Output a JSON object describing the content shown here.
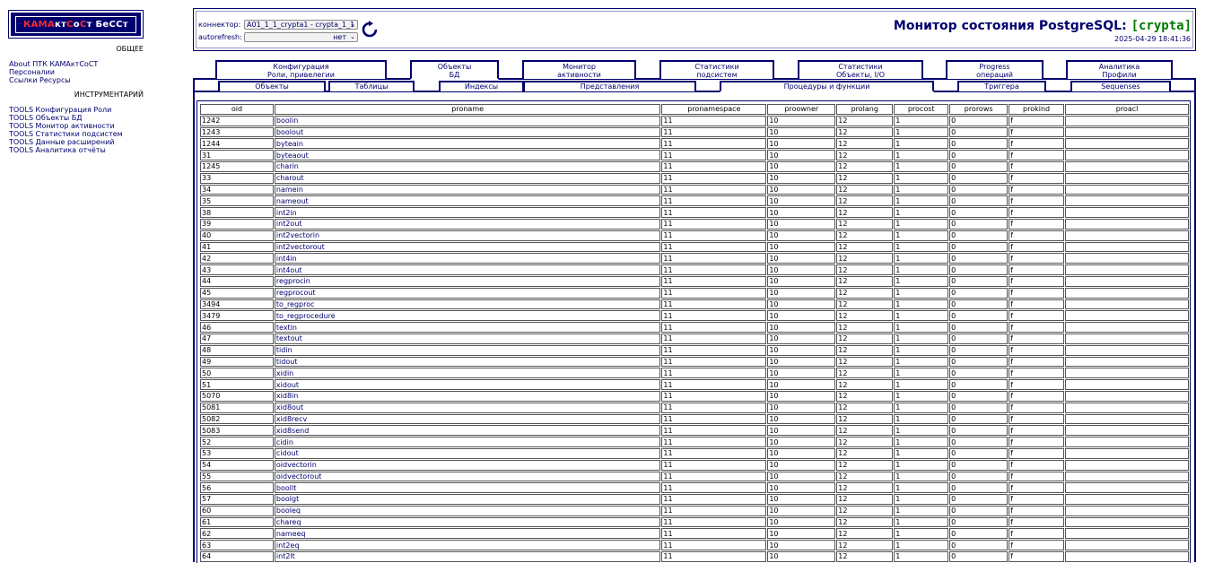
{
  "sidebar": {
    "logo": {
      "part1": "КАМА",
      "part2": "кт",
      "part3": "С",
      "part4": "о",
      "part5": "С",
      "part6": "т БеССт"
    },
    "section_general": "ОБЩЕЕ",
    "general_links": [
      "About ПТК КАМАктСоСТ",
      "Персоналии",
      "Ссылки Ресурсы"
    ],
    "section_tools": "ИНСТРУМЕНТАРИЙ",
    "tools_links": [
      "TOOLS Конфигурация Роли",
      "TOOLS Объекты БД",
      "TOOLS Монитор активности",
      "TOOLS Статистики подсистем",
      "TOOLS Данные расширений",
      "TOOLS Аналитика отчёты"
    ]
  },
  "header": {
    "connector_label": "коннектор:",
    "connector_value": "A01_1_1_crypta1 - crypta_1_1",
    "autorefresh_label": "autorefresh:",
    "autorefresh_value": "нет",
    "title_prefix": "Монитор состояния PostgreSQL:",
    "title_db": "[crypta]",
    "timestamp": "2025-04-29 18:41:36"
  },
  "main_tabs": [
    {
      "line1": "Конфигурация",
      "line2": "Роли, привелегии",
      "active": false
    },
    {
      "line1": "Объекты",
      "line2": "БД",
      "active": true
    },
    {
      "line1": "Монитор",
      "line2": "активности",
      "active": false
    },
    {
      "line1": "Статистики",
      "line2": "подсистем",
      "active": false
    },
    {
      "line1": "Статистики",
      "line2": "Объекты, I/O",
      "active": false
    },
    {
      "line1": "Progress",
      "line2": "операций",
      "active": false
    },
    {
      "line1": "Аналитика",
      "line2": "Профили",
      "active": false
    }
  ],
  "sub_tabs": [
    {
      "label": "Объекты",
      "active": false
    },
    {
      "label": "Таблицы",
      "active": false
    },
    {
      "label": "Индексы",
      "active": false
    },
    {
      "label": "Представления",
      "active": false
    },
    {
      "label": "Процедуры и функции",
      "active": true
    },
    {
      "label": "Триггера",
      "active": false
    },
    {
      "label": "Sequenses",
      "active": false
    }
  ],
  "table": {
    "columns": [
      "oid",
      "proname",
      "pronamespace",
      "proowner",
      "prolang",
      "procost",
      "prorows",
      "prokind",
      "proacl"
    ],
    "rows": [
      [
        "1242",
        "boolin",
        "11",
        "10",
        "12",
        "1",
        "0",
        "f",
        ""
      ],
      [
        "1243",
        "boolout",
        "11",
        "10",
        "12",
        "1",
        "0",
        "f",
        ""
      ],
      [
        "1244",
        "byteain",
        "11",
        "10",
        "12",
        "1",
        "0",
        "f",
        ""
      ],
      [
        "31",
        "byteaout",
        "11",
        "10",
        "12",
        "1",
        "0",
        "f",
        ""
      ],
      [
        "1245",
        "charin",
        "11",
        "10",
        "12",
        "1",
        "0",
        "f",
        ""
      ],
      [
        "33",
        "charout",
        "11",
        "10",
        "12",
        "1",
        "0",
        "f",
        ""
      ],
      [
        "34",
        "namein",
        "11",
        "10",
        "12",
        "1",
        "0",
        "f",
        ""
      ],
      [
        "35",
        "nameout",
        "11",
        "10",
        "12",
        "1",
        "0",
        "f",
        ""
      ],
      [
        "38",
        "int2in",
        "11",
        "10",
        "12",
        "1",
        "0",
        "f",
        ""
      ],
      [
        "39",
        "int2out",
        "11",
        "10",
        "12",
        "1",
        "0",
        "f",
        ""
      ],
      [
        "40",
        "int2vectorin",
        "11",
        "10",
        "12",
        "1",
        "0",
        "f",
        ""
      ],
      [
        "41",
        "int2vectorout",
        "11",
        "10",
        "12",
        "1",
        "0",
        "f",
        ""
      ],
      [
        "42",
        "int4in",
        "11",
        "10",
        "12",
        "1",
        "0",
        "f",
        ""
      ],
      [
        "43",
        "int4out",
        "11",
        "10",
        "12",
        "1",
        "0",
        "f",
        ""
      ],
      [
        "44",
        "regprocin",
        "11",
        "10",
        "12",
        "1",
        "0",
        "f",
        ""
      ],
      [
        "45",
        "regprocout",
        "11",
        "10",
        "12",
        "1",
        "0",
        "f",
        ""
      ],
      [
        "3494",
        "to_regproc",
        "11",
        "10",
        "12",
        "1",
        "0",
        "f",
        ""
      ],
      [
        "3479",
        "to_regprocedure",
        "11",
        "10",
        "12",
        "1",
        "0",
        "f",
        ""
      ],
      [
        "46",
        "textin",
        "11",
        "10",
        "12",
        "1",
        "0",
        "f",
        ""
      ],
      [
        "47",
        "textout",
        "11",
        "10",
        "12",
        "1",
        "0",
        "f",
        ""
      ],
      [
        "48",
        "tidin",
        "11",
        "10",
        "12",
        "1",
        "0",
        "f",
        ""
      ],
      [
        "49",
        "tidout",
        "11",
        "10",
        "12",
        "1",
        "0",
        "f",
        ""
      ],
      [
        "50",
        "xidin",
        "11",
        "10",
        "12",
        "1",
        "0",
        "f",
        ""
      ],
      [
        "51",
        "xidout",
        "11",
        "10",
        "12",
        "1",
        "0",
        "f",
        ""
      ],
      [
        "5070",
        "xid8in",
        "11",
        "10",
        "12",
        "1",
        "0",
        "f",
        ""
      ],
      [
        "5081",
        "xid8out",
        "11",
        "10",
        "12",
        "1",
        "0",
        "f",
        ""
      ],
      [
        "5082",
        "xid8recv",
        "11",
        "10",
        "12",
        "1",
        "0",
        "f",
        ""
      ],
      [
        "5083",
        "xid8send",
        "11",
        "10",
        "12",
        "1",
        "0",
        "f",
        ""
      ],
      [
        "52",
        "cidin",
        "11",
        "10",
        "12",
        "1",
        "0",
        "f",
        ""
      ],
      [
        "53",
        "cidout",
        "11",
        "10",
        "12",
        "1",
        "0",
        "f",
        ""
      ],
      [
        "54",
        "oidvectorin",
        "11",
        "10",
        "12",
        "1",
        "0",
        "f",
        ""
      ],
      [
        "55",
        "oidvectorout",
        "11",
        "10",
        "12",
        "1",
        "0",
        "f",
        ""
      ],
      [
        "56",
        "boollt",
        "11",
        "10",
        "12",
        "1",
        "0",
        "f",
        ""
      ],
      [
        "57",
        "boolgt",
        "11",
        "10",
        "12",
        "1",
        "0",
        "f",
        ""
      ],
      [
        "60",
        "booleq",
        "11",
        "10",
        "12",
        "1",
        "0",
        "f",
        ""
      ],
      [
        "61",
        "chareq",
        "11",
        "10",
        "12",
        "1",
        "0",
        "f",
        ""
      ],
      [
        "62",
        "nameeq",
        "11",
        "10",
        "12",
        "1",
        "0",
        "f",
        ""
      ],
      [
        "63",
        "int2eq",
        "11",
        "10",
        "12",
        "1",
        "0",
        "f",
        ""
      ],
      [
        "64",
        "int2lt",
        "11",
        "10",
        "12",
        "1",
        "0",
        "f",
        ""
      ]
    ]
  },
  "colors": {
    "navy": "#00006e",
    "logo_red": "#ff2a2a",
    "db_green": "#007a00"
  },
  "icons": {
    "refresh": "refresh-icon"
  }
}
